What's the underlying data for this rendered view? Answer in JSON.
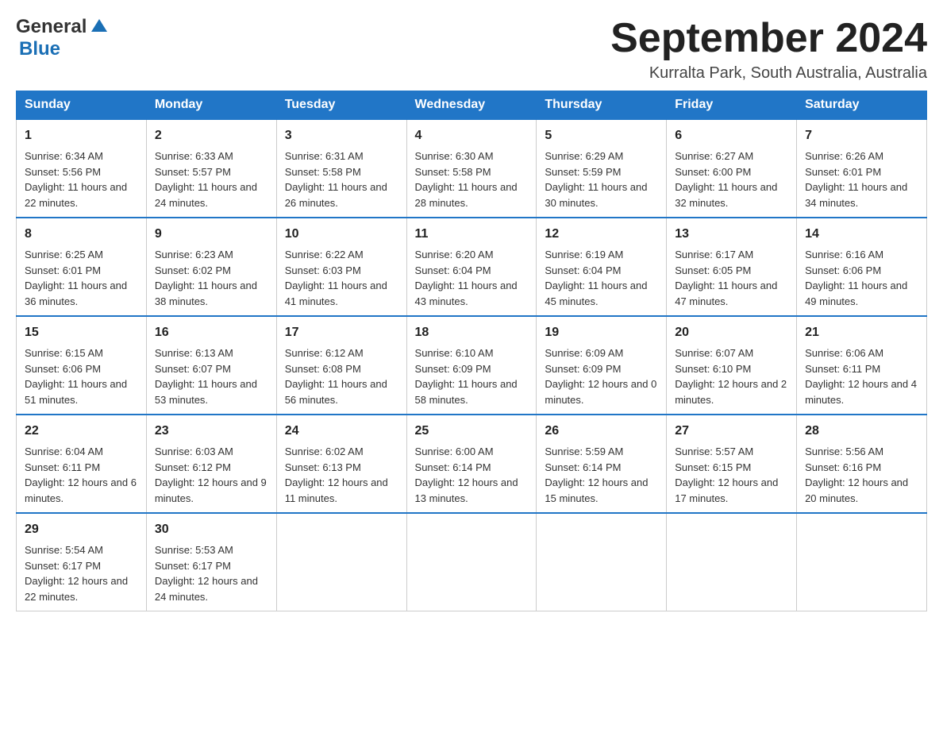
{
  "header": {
    "logo_general": "General",
    "logo_blue": "Blue",
    "month_title": "September 2024",
    "location": "Kurralta Park, South Australia, Australia"
  },
  "days_of_week": [
    "Sunday",
    "Monday",
    "Tuesday",
    "Wednesday",
    "Thursday",
    "Friday",
    "Saturday"
  ],
  "weeks": [
    [
      {
        "day": "1",
        "sunrise": "6:34 AM",
        "sunset": "5:56 PM",
        "daylight": "11 hours and 22 minutes."
      },
      {
        "day": "2",
        "sunrise": "6:33 AM",
        "sunset": "5:57 PM",
        "daylight": "11 hours and 24 minutes."
      },
      {
        "day": "3",
        "sunrise": "6:31 AM",
        "sunset": "5:58 PM",
        "daylight": "11 hours and 26 minutes."
      },
      {
        "day": "4",
        "sunrise": "6:30 AM",
        "sunset": "5:58 PM",
        "daylight": "11 hours and 28 minutes."
      },
      {
        "day": "5",
        "sunrise": "6:29 AM",
        "sunset": "5:59 PM",
        "daylight": "11 hours and 30 minutes."
      },
      {
        "day": "6",
        "sunrise": "6:27 AM",
        "sunset": "6:00 PM",
        "daylight": "11 hours and 32 minutes."
      },
      {
        "day": "7",
        "sunrise": "6:26 AM",
        "sunset": "6:01 PM",
        "daylight": "11 hours and 34 minutes."
      }
    ],
    [
      {
        "day": "8",
        "sunrise": "6:25 AM",
        "sunset": "6:01 PM",
        "daylight": "11 hours and 36 minutes."
      },
      {
        "day": "9",
        "sunrise": "6:23 AM",
        "sunset": "6:02 PM",
        "daylight": "11 hours and 38 minutes."
      },
      {
        "day": "10",
        "sunrise": "6:22 AM",
        "sunset": "6:03 PM",
        "daylight": "11 hours and 41 minutes."
      },
      {
        "day": "11",
        "sunrise": "6:20 AM",
        "sunset": "6:04 PM",
        "daylight": "11 hours and 43 minutes."
      },
      {
        "day": "12",
        "sunrise": "6:19 AM",
        "sunset": "6:04 PM",
        "daylight": "11 hours and 45 minutes."
      },
      {
        "day": "13",
        "sunrise": "6:17 AM",
        "sunset": "6:05 PM",
        "daylight": "11 hours and 47 minutes."
      },
      {
        "day": "14",
        "sunrise": "6:16 AM",
        "sunset": "6:06 PM",
        "daylight": "11 hours and 49 minutes."
      }
    ],
    [
      {
        "day": "15",
        "sunrise": "6:15 AM",
        "sunset": "6:06 PM",
        "daylight": "11 hours and 51 minutes."
      },
      {
        "day": "16",
        "sunrise": "6:13 AM",
        "sunset": "6:07 PM",
        "daylight": "11 hours and 53 minutes."
      },
      {
        "day": "17",
        "sunrise": "6:12 AM",
        "sunset": "6:08 PM",
        "daylight": "11 hours and 56 minutes."
      },
      {
        "day": "18",
        "sunrise": "6:10 AM",
        "sunset": "6:09 PM",
        "daylight": "11 hours and 58 minutes."
      },
      {
        "day": "19",
        "sunrise": "6:09 AM",
        "sunset": "6:09 PM",
        "daylight": "12 hours and 0 minutes."
      },
      {
        "day": "20",
        "sunrise": "6:07 AM",
        "sunset": "6:10 PM",
        "daylight": "12 hours and 2 minutes."
      },
      {
        "day": "21",
        "sunrise": "6:06 AM",
        "sunset": "6:11 PM",
        "daylight": "12 hours and 4 minutes."
      }
    ],
    [
      {
        "day": "22",
        "sunrise": "6:04 AM",
        "sunset": "6:11 PM",
        "daylight": "12 hours and 6 minutes."
      },
      {
        "day": "23",
        "sunrise": "6:03 AM",
        "sunset": "6:12 PM",
        "daylight": "12 hours and 9 minutes."
      },
      {
        "day": "24",
        "sunrise": "6:02 AM",
        "sunset": "6:13 PM",
        "daylight": "12 hours and 11 minutes."
      },
      {
        "day": "25",
        "sunrise": "6:00 AM",
        "sunset": "6:14 PM",
        "daylight": "12 hours and 13 minutes."
      },
      {
        "day": "26",
        "sunrise": "5:59 AM",
        "sunset": "6:14 PM",
        "daylight": "12 hours and 15 minutes."
      },
      {
        "day": "27",
        "sunrise": "5:57 AM",
        "sunset": "6:15 PM",
        "daylight": "12 hours and 17 minutes."
      },
      {
        "day": "28",
        "sunrise": "5:56 AM",
        "sunset": "6:16 PM",
        "daylight": "12 hours and 20 minutes."
      }
    ],
    [
      {
        "day": "29",
        "sunrise": "5:54 AM",
        "sunset": "6:17 PM",
        "daylight": "12 hours and 22 minutes."
      },
      {
        "day": "30",
        "sunrise": "5:53 AM",
        "sunset": "6:17 PM",
        "daylight": "12 hours and 24 minutes."
      },
      null,
      null,
      null,
      null,
      null
    ]
  ]
}
